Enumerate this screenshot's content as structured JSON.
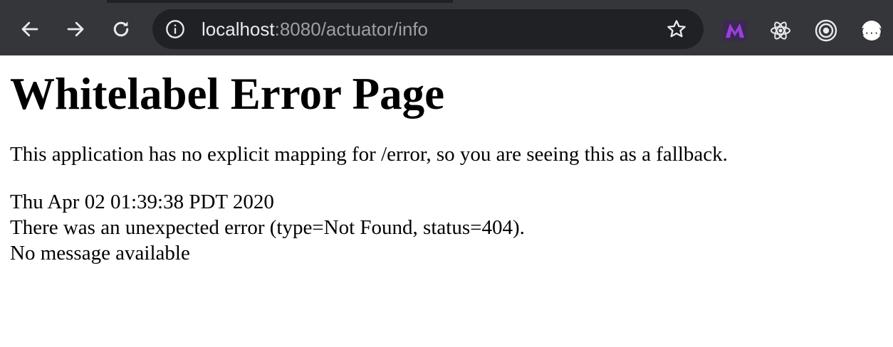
{
  "browser": {
    "url_host": "localhost",
    "url_rest": ":8080/actuator/info",
    "nav": {
      "back_icon": "arrow-left-icon",
      "forward_icon": "arrow-right-icon",
      "reload_icon": "reload-icon"
    },
    "site_info_icon": "info-circle-icon",
    "bookmark_icon": "star-icon",
    "extensions": [
      {
        "icon": "m-logo-icon",
        "color": "#7b2fd8"
      },
      {
        "icon": "react-atom-icon",
        "color": "#e8eaed"
      },
      {
        "icon": "target-rings-icon",
        "color": "#e8eaed"
      },
      {
        "icon": "json-braces-icon",
        "color": "#ffffff"
      }
    ],
    "colors": {
      "toolbar": "#35363a",
      "omnibox": "#202124",
      "icon": "#e8eaed"
    }
  },
  "page": {
    "title": "Whitelabel Error Page",
    "description": "This application has no explicit mapping for /error, so you are seeing this as a fallback.",
    "timestamp": "Thu Apr 02 01:39:38 PDT 2020",
    "error_line": "There was an unexpected error (type=Not Found, status=404).",
    "message": "No message available"
  }
}
